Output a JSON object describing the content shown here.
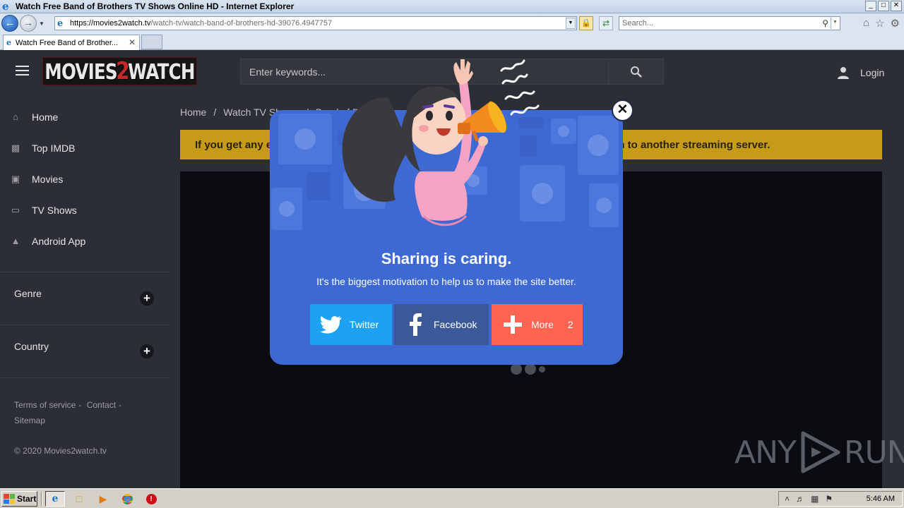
{
  "window": {
    "title": "Watch Free Band of Brothers TV Shows Online HD - Internet Explorer",
    "buttons": [
      "_",
      "□",
      "✕"
    ]
  },
  "addressbar": {
    "url_host": "https://movies2watch.tv",
    "url_path": "/watch-tv/watch-band-of-brothers-hd-39076.4947757",
    "search_placeholder": "Search..."
  },
  "tabs": [
    {
      "label": "Watch Free Band of Brother..."
    }
  ],
  "site": {
    "logo": {
      "left": "MOVIES",
      "mid": "2",
      "right": "WATCH"
    },
    "search_placeholder": "Enter keywords...",
    "login_label": "Login",
    "nav": [
      {
        "label": "Home",
        "icon": "home-icon"
      },
      {
        "label": "Top IMDB",
        "icon": "imdb-icon"
      },
      {
        "label": "Movies",
        "icon": "film-icon"
      },
      {
        "label": "TV Shows",
        "icon": "tv-icon"
      },
      {
        "label": "Android App",
        "icon": "android-icon"
      }
    ],
    "sections": [
      {
        "label": "Genre"
      },
      {
        "label": "Country"
      }
    ],
    "footer": {
      "terms": "Terms of service",
      "contact": "Contact",
      "sitemap": "Sitemap",
      "sep": "-",
      "copyright": "© 2020 Movies2watch.tv"
    },
    "breadcrumb": [
      "Home",
      "/",
      "Watch TV Shows",
      "/",
      "Band of Brothers"
    ],
    "alert_left": "If you get any e",
    "alert_right": "ch to another streaming server."
  },
  "modal": {
    "title": "Sharing is caring.",
    "subtitle": "It's the biggest motivation to help us to make the site better.",
    "buttons": {
      "twitter": "Twitter",
      "facebook": "Facebook",
      "more": "More",
      "more_count": "2"
    },
    "close": "✕"
  },
  "watermark": {
    "left": "ANY",
    "right": "RUN"
  },
  "taskbar": {
    "start": "Start",
    "clock": "5:46 AM"
  },
  "colors": {
    "modal_bg": "#3f69d2",
    "twitter": "#1da1f2",
    "facebook": "#3b5998",
    "more": "#ff6550",
    "alert": "#c69b17"
  }
}
